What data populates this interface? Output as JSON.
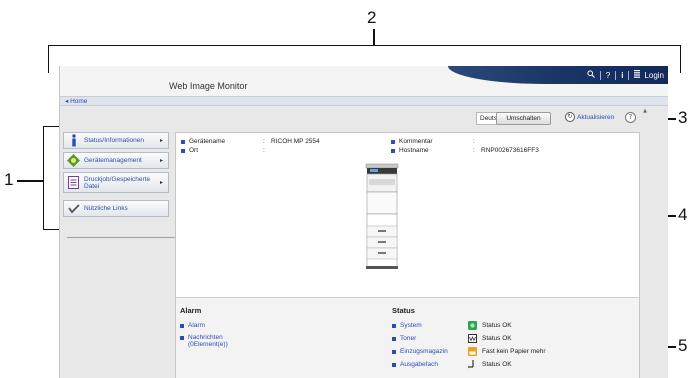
{
  "callouts": [
    "1",
    "2",
    "3",
    "4",
    "5"
  ],
  "header": {
    "app_title": "Web Image Monitor",
    "tools": [
      "search",
      "help",
      "info",
      "menu"
    ],
    "login_label": "Login"
  },
  "nav": {
    "home_label": "Home"
  },
  "toolbar": {
    "language_value": "Deutsch",
    "switch_label": "Umschalten",
    "refresh_label": "Aktualisieren",
    "help_symbol": "?"
  },
  "sidebar": {
    "items": [
      {
        "label": "Status/Informationen",
        "icon": "info-icon"
      },
      {
        "label": "Gerätemanagement",
        "icon": "device-management-icon"
      },
      {
        "label": "Druckjob/Gespeicherte Datei",
        "icon": "document-icon"
      },
      {
        "label": "Nützliche Links",
        "icon": "link-icon"
      }
    ]
  },
  "device_info": {
    "rows": [
      {
        "key": "Gerätename",
        "value": "RICOH MP 2554"
      },
      {
        "key": "Ort",
        "value": ""
      },
      {
        "key": "Kommentar",
        "value": ""
      },
      {
        "key": "Hostname",
        "value": "RNP002673616FF3"
      }
    ]
  },
  "alarm": {
    "title": "Alarm",
    "items": [
      "Alarm",
      "Nachrichten (0Element(e))"
    ]
  },
  "status": {
    "title": "Status",
    "items": [
      {
        "label": "System",
        "value": "Status OK",
        "icon": "green-ok-icon",
        "color": "#2ea44f"
      },
      {
        "label": "Toner",
        "value": "Status OK",
        "icon": "toner-icon",
        "color": "#333333"
      },
      {
        "label": "Einzugsmagazin",
        "value": "Fast kein Papier mehr",
        "icon": "paper-warning-icon",
        "color": "#f0a020"
      },
      {
        "label": "Ausgabefach",
        "value": "Status OK",
        "icon": "output-tray-icon",
        "color": "#333333"
      }
    ]
  },
  "colors": {
    "link": "#2a4fb0",
    "header_band": "#1a3566"
  }
}
